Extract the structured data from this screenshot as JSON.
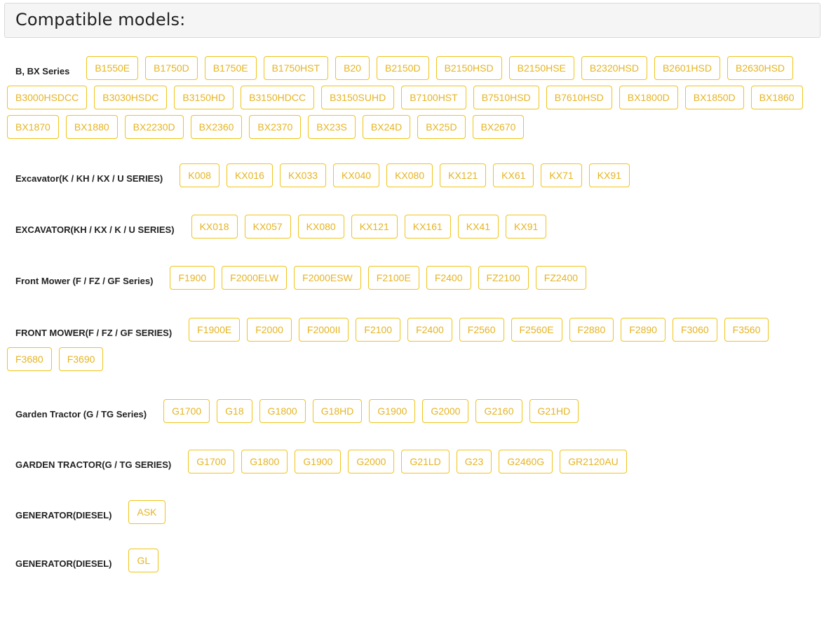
{
  "header": {
    "title": "Compatible models:"
  },
  "colors": {
    "accent": "#f0c419",
    "chip_text": "#e6b422"
  },
  "groups": [
    {
      "label": "B, BX Series",
      "models": [
        "B1550E",
        "B1750D",
        "B1750E",
        "B1750HST",
        "B20",
        "B2150D",
        "B2150HSD",
        "B2150HSE",
        "B2320HSD",
        "B2601HSD",
        "B2630HSD",
        "B3000HSDCC",
        "B3030HSDC",
        "B3150HD",
        "B3150HDCC",
        "B3150SUHD",
        "B7100HST",
        "B7510HSD",
        "B7610HSD",
        "BX1800D",
        "BX1850D",
        "BX1860",
        "BX1870",
        "BX1880",
        "BX2230D",
        "BX2360",
        "BX2370",
        "BX23S",
        "BX24D",
        "BX25D",
        "BX2670"
      ]
    },
    {
      "label": "Excavator(K / KH / KX / U SERIES)",
      "models": [
        "K008",
        "KX016",
        "KX033",
        "KX040",
        "KX080",
        "KX121",
        "KX61",
        "KX71",
        "KX91"
      ]
    },
    {
      "label": "EXCAVATOR(KH / KX / K / U SERIES)",
      "models": [
        "KX018",
        "KX057",
        "KX080",
        "KX121",
        "KX161",
        "KX41",
        "KX91"
      ]
    },
    {
      "label": "Front Mower (F / FZ / GF Series)",
      "models": [
        "F1900",
        "F2000ELW",
        "F2000ESW",
        "F2100E",
        "F2400",
        "FZ2100",
        "FZ2400"
      ]
    },
    {
      "label": "FRONT MOWER(F / FZ / GF SERIES)",
      "models": [
        "F1900E",
        "F2000",
        "F2000II",
        "F2100",
        "F2400",
        "F2560",
        "F2560E",
        "F2880",
        "F2890",
        "F3060",
        "F3560",
        "F3680",
        "F3690"
      ]
    },
    {
      "label": "Garden Tractor (G / TG Series)",
      "models": [
        "G1700",
        "G18",
        "G1800",
        "G18HD",
        "G1900",
        "G2000",
        "G2160",
        "G21HD"
      ]
    },
    {
      "label": "GARDEN TRACTOR(G / TG SERIES)",
      "models": [
        "G1700",
        "G1800",
        "G1900",
        "G2000",
        "G21LD",
        "G23",
        "G2460G",
        "GR2120AU"
      ]
    },
    {
      "label": "GENERATOR(DIESEL)",
      "models": [
        "ASK"
      ]
    },
    {
      "label": "GENERATOR(DIESEL)",
      "models": [
        "GL"
      ]
    }
  ]
}
